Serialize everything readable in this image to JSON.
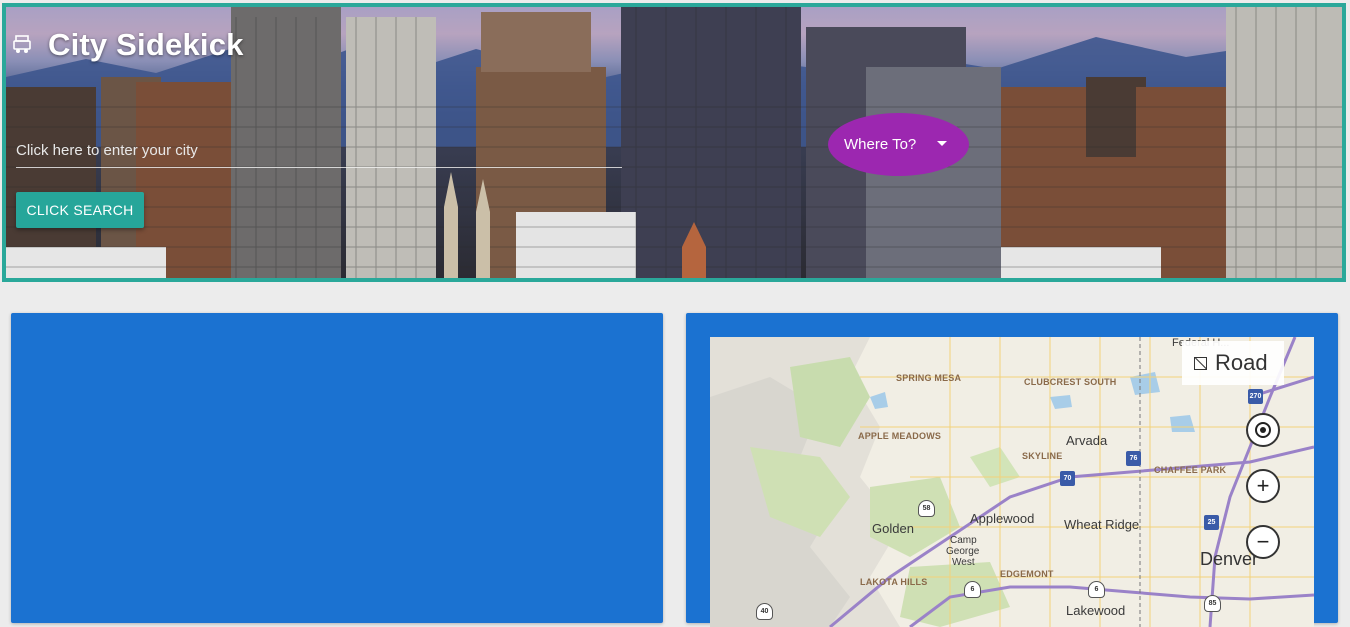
{
  "app": {
    "title": "City Sidekick"
  },
  "search": {
    "placeholder": "Click here to enter your city",
    "button_label": "CLICK SEARCH"
  },
  "destination": {
    "label": "Where To?"
  },
  "map": {
    "road_label": "Road",
    "labels": {
      "spring_mesa": "SPRING MESA",
      "clubcrest_south": "CLUBCREST SOUTH",
      "apple_meadows": "APPLE MEADOWS",
      "skyline": "SKYLINE",
      "chaffee_park": "CHAFFEE PARK",
      "lakota_hills": "LAKOTA HILLS",
      "edgemont": "EDGEMONT",
      "arvada": "Arvada",
      "golden": "Golden",
      "applewood": "Applewood",
      "wheat_ridge": "Wheat Ridge",
      "camp_george_west_1": "Camp",
      "camp_george_west_2": "George",
      "camp_george_west_3": "West",
      "denver": "Denver",
      "lakewood": "Lakewood",
      "federal_heights": "Federal H..."
    },
    "shields": [
      "270",
      "76",
      "70",
      "58",
      "6",
      "25",
      "6",
      "85",
      "40"
    ],
    "controls": {
      "locate": "locate-me",
      "zoom_in": "+",
      "zoom_out": "−"
    }
  }
}
